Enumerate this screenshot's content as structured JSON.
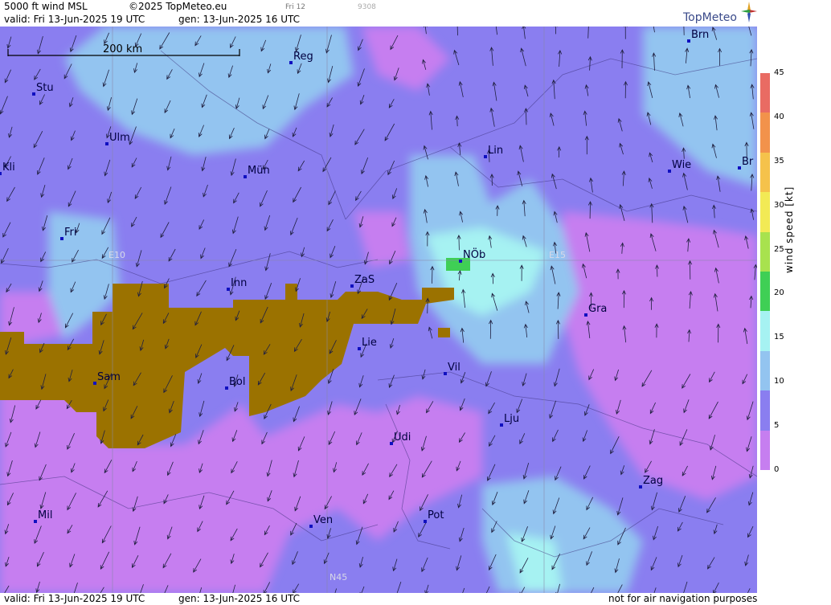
{
  "header": {
    "product": "5000 ft wind MSL",
    "copyright": "©2025 TopMeteo.eu",
    "valid": "valid:  Fri  13-Jun-2025  19 UTC",
    "gen": "gen: 13-Jun-2025 16 UTC",
    "day_tab": "Fri 12",
    "code": "9308",
    "brand": "TopMeteo"
  },
  "footer": {
    "valid": "valid:  Fri  13-Jun-2025  19 UTC",
    "gen": "gen: 13-Jun-2025 16 UTC",
    "disclaimer": "not for air navigation purposes"
  },
  "map": {
    "scale_label": "200 km",
    "grid_labels": [
      "E10",
      "E15",
      "N45"
    ],
    "cities": [
      "Brn",
      "Reg",
      "Stu",
      "Ulm",
      "Kli",
      "Mün",
      "Lin",
      "Wie",
      "Br",
      "Fri",
      "NÖb",
      "Inn",
      "ZaS",
      "Gra",
      "Lie",
      "Vil",
      "Sam",
      "Bol",
      "Lju",
      "Udi",
      "Zag",
      "Mil",
      "Ven",
      "Pot"
    ],
    "wind_arrow_icon": "wind-arrow-icon",
    "terrain_colour": "#9b7200"
  },
  "legend": {
    "title": "wind  speed  [kt]",
    "ticks": [
      "45",
      "40",
      "35",
      "30",
      "25",
      "20",
      "15",
      "10",
      "5",
      "0"
    ],
    "colors": [
      "#e96b63",
      "#f2924b",
      "#f5c24b",
      "#f2ea55",
      "#a8e24e",
      "#3fcf55",
      "#a6f2f2",
      "#93c4f0",
      "#8a7ef0",
      "#c67ef0"
    ]
  }
}
